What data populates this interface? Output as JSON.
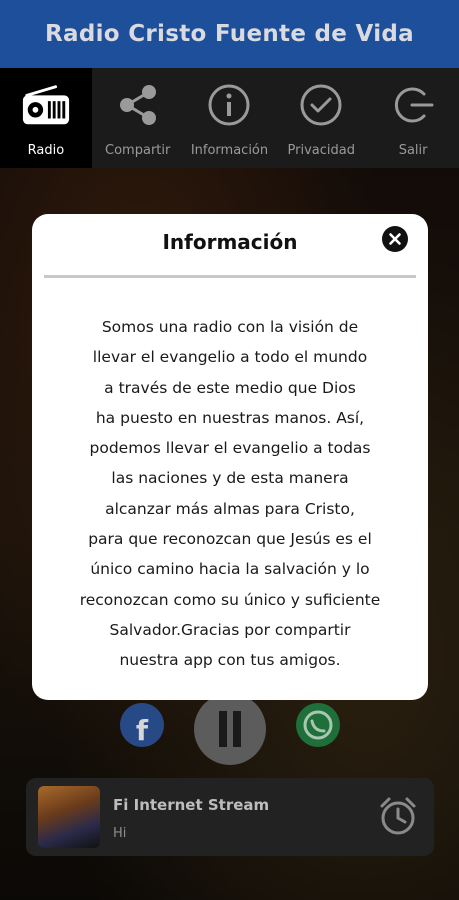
{
  "app": {
    "title": "Radio Cristo Fuente de Vida"
  },
  "nav": {
    "items": [
      {
        "label": "Radio",
        "icon": "radio-icon"
      },
      {
        "label": "Compartir",
        "icon": "share-icon"
      },
      {
        "label": "Información",
        "icon": "info-icon"
      },
      {
        "label": "Privacidad",
        "icon": "check-circle-icon"
      },
      {
        "label": "Salir",
        "icon": "logout-icon"
      }
    ]
  },
  "modal": {
    "title": "Información",
    "lines": [
      "Somos una radio con la visión de",
      "llevar el evangelio a todo el mundo",
      "a través de este medio que Dios",
      "ha puesto en nuestras manos. Así,",
      "podemos llevar el evangelio a todas",
      "las naciones y de esta manera",
      "alcanzar más almas para Cristo,",
      "para que reconozcan que Jesús es el",
      "único camino hacia la salvación y lo",
      "reconozcan como su único y suficiente",
      "Salvador.Gracias por compartir",
      "nuestra app con tus amigos."
    ]
  },
  "player": {
    "stream_name": "Fi Internet Stream",
    "subtitle": "Hi"
  },
  "colors": {
    "app_bar": "#1d4f9a",
    "nav_bg": "#1b1b1b",
    "active_tab": "#000000"
  }
}
